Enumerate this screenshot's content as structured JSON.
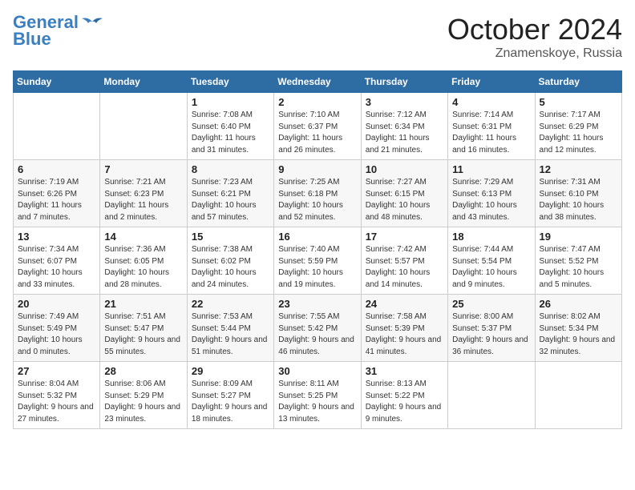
{
  "header": {
    "logo_line1": "General",
    "logo_line2": "Blue",
    "month": "October 2024",
    "location": "Znamenskoye, Russia"
  },
  "weekdays": [
    "Sunday",
    "Monday",
    "Tuesday",
    "Wednesday",
    "Thursday",
    "Friday",
    "Saturday"
  ],
  "weeks": [
    [
      {
        "day": "",
        "info": ""
      },
      {
        "day": "",
        "info": ""
      },
      {
        "day": "1",
        "info": "Sunrise: 7:08 AM\nSunset: 6:40 PM\nDaylight: 11 hours and 31 minutes."
      },
      {
        "day": "2",
        "info": "Sunrise: 7:10 AM\nSunset: 6:37 PM\nDaylight: 11 hours and 26 minutes."
      },
      {
        "day": "3",
        "info": "Sunrise: 7:12 AM\nSunset: 6:34 PM\nDaylight: 11 hours and 21 minutes."
      },
      {
        "day": "4",
        "info": "Sunrise: 7:14 AM\nSunset: 6:31 PM\nDaylight: 11 hours and 16 minutes."
      },
      {
        "day": "5",
        "info": "Sunrise: 7:17 AM\nSunset: 6:29 PM\nDaylight: 11 hours and 12 minutes."
      }
    ],
    [
      {
        "day": "6",
        "info": "Sunrise: 7:19 AM\nSunset: 6:26 PM\nDaylight: 11 hours and 7 minutes."
      },
      {
        "day": "7",
        "info": "Sunrise: 7:21 AM\nSunset: 6:23 PM\nDaylight: 11 hours and 2 minutes."
      },
      {
        "day": "8",
        "info": "Sunrise: 7:23 AM\nSunset: 6:21 PM\nDaylight: 10 hours and 57 minutes."
      },
      {
        "day": "9",
        "info": "Sunrise: 7:25 AM\nSunset: 6:18 PM\nDaylight: 10 hours and 52 minutes."
      },
      {
        "day": "10",
        "info": "Sunrise: 7:27 AM\nSunset: 6:15 PM\nDaylight: 10 hours and 48 minutes."
      },
      {
        "day": "11",
        "info": "Sunrise: 7:29 AM\nSunset: 6:13 PM\nDaylight: 10 hours and 43 minutes."
      },
      {
        "day": "12",
        "info": "Sunrise: 7:31 AM\nSunset: 6:10 PM\nDaylight: 10 hours and 38 minutes."
      }
    ],
    [
      {
        "day": "13",
        "info": "Sunrise: 7:34 AM\nSunset: 6:07 PM\nDaylight: 10 hours and 33 minutes."
      },
      {
        "day": "14",
        "info": "Sunrise: 7:36 AM\nSunset: 6:05 PM\nDaylight: 10 hours and 28 minutes."
      },
      {
        "day": "15",
        "info": "Sunrise: 7:38 AM\nSunset: 6:02 PM\nDaylight: 10 hours and 24 minutes."
      },
      {
        "day": "16",
        "info": "Sunrise: 7:40 AM\nSunset: 5:59 PM\nDaylight: 10 hours and 19 minutes."
      },
      {
        "day": "17",
        "info": "Sunrise: 7:42 AM\nSunset: 5:57 PM\nDaylight: 10 hours and 14 minutes."
      },
      {
        "day": "18",
        "info": "Sunrise: 7:44 AM\nSunset: 5:54 PM\nDaylight: 10 hours and 9 minutes."
      },
      {
        "day": "19",
        "info": "Sunrise: 7:47 AM\nSunset: 5:52 PM\nDaylight: 10 hours and 5 minutes."
      }
    ],
    [
      {
        "day": "20",
        "info": "Sunrise: 7:49 AM\nSunset: 5:49 PM\nDaylight: 10 hours and 0 minutes."
      },
      {
        "day": "21",
        "info": "Sunrise: 7:51 AM\nSunset: 5:47 PM\nDaylight: 9 hours and 55 minutes."
      },
      {
        "day": "22",
        "info": "Sunrise: 7:53 AM\nSunset: 5:44 PM\nDaylight: 9 hours and 51 minutes."
      },
      {
        "day": "23",
        "info": "Sunrise: 7:55 AM\nSunset: 5:42 PM\nDaylight: 9 hours and 46 minutes."
      },
      {
        "day": "24",
        "info": "Sunrise: 7:58 AM\nSunset: 5:39 PM\nDaylight: 9 hours and 41 minutes."
      },
      {
        "day": "25",
        "info": "Sunrise: 8:00 AM\nSunset: 5:37 PM\nDaylight: 9 hours and 36 minutes."
      },
      {
        "day": "26",
        "info": "Sunrise: 8:02 AM\nSunset: 5:34 PM\nDaylight: 9 hours and 32 minutes."
      }
    ],
    [
      {
        "day": "27",
        "info": "Sunrise: 8:04 AM\nSunset: 5:32 PM\nDaylight: 9 hours and 27 minutes."
      },
      {
        "day": "28",
        "info": "Sunrise: 8:06 AM\nSunset: 5:29 PM\nDaylight: 9 hours and 23 minutes."
      },
      {
        "day": "29",
        "info": "Sunrise: 8:09 AM\nSunset: 5:27 PM\nDaylight: 9 hours and 18 minutes."
      },
      {
        "day": "30",
        "info": "Sunrise: 8:11 AM\nSunset: 5:25 PM\nDaylight: 9 hours and 13 minutes."
      },
      {
        "day": "31",
        "info": "Sunrise: 8:13 AM\nSunset: 5:22 PM\nDaylight: 9 hours and 9 minutes."
      },
      {
        "day": "",
        "info": ""
      },
      {
        "day": "",
        "info": ""
      }
    ]
  ]
}
